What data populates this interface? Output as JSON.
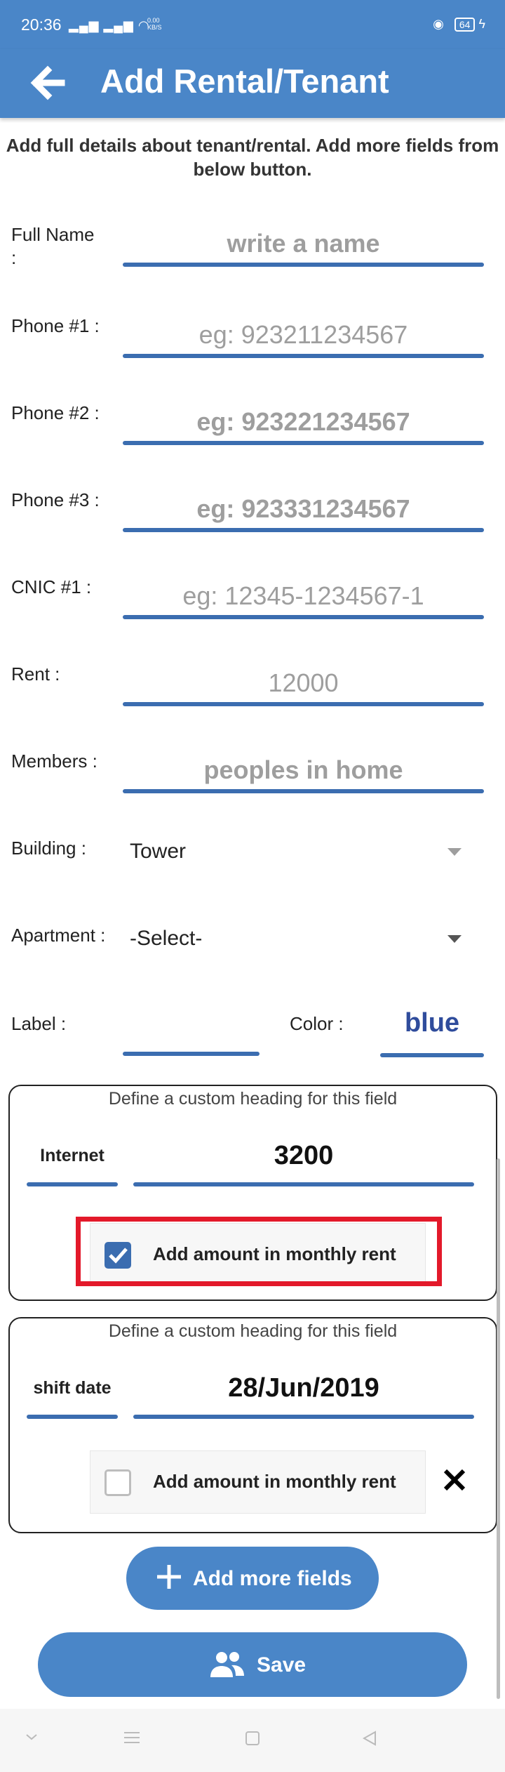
{
  "status_bar": {
    "time": "20:36",
    "network_speed": "0.00 KB/S",
    "battery": "64"
  },
  "app_bar": {
    "title": "Add Rental/Tenant"
  },
  "intro": "Add full details about tenant/rental. Add more fields from below button.",
  "form": {
    "full_name": {
      "label": "Full Name :",
      "placeholder": "write a name"
    },
    "phone1": {
      "label": "Phone #1 :",
      "placeholder": "eg: 923211234567"
    },
    "phone2": {
      "label": "Phone #2 :",
      "placeholder": "eg: 923221234567"
    },
    "phone3": {
      "label": "Phone #3 :",
      "placeholder": "eg: 923331234567"
    },
    "cnic1": {
      "label": "CNIC #1 :",
      "placeholder": "eg: 12345-1234567-1"
    },
    "rent": {
      "label": "Rent :",
      "placeholder": "12000"
    },
    "members": {
      "label": "Members :",
      "placeholder": "peoples in home"
    },
    "building": {
      "label": "Building :",
      "value": "Tower"
    },
    "apartment": {
      "label": "Apartment :",
      "value": "-Select-"
    },
    "label_field": {
      "label": "Label :",
      "value": ""
    },
    "color": {
      "label": "Color :",
      "value": "blue"
    }
  },
  "custom_fields": [
    {
      "hint": "Define a custom heading for this field",
      "heading": "Internet",
      "amount": "3200",
      "checkbox_label": "Add amount in monthly rent",
      "checked": true
    },
    {
      "hint": "Define a custom heading for this field",
      "heading": "shift date",
      "amount": "28/Jun/2019",
      "checkbox_label": "Add amount in monthly rent",
      "checked": false
    }
  ],
  "buttons": {
    "add_more": "Add more fields",
    "save": "Save"
  },
  "colors": {
    "primary": "#4a86c8",
    "underline": "#3b6db0",
    "highlight": "#e3192a"
  },
  "icons": [
    "back-arrow-icon",
    "plus-icon",
    "people-icon",
    "close-icon",
    "checkbox-icon",
    "dropdown-arrow-icon"
  ]
}
